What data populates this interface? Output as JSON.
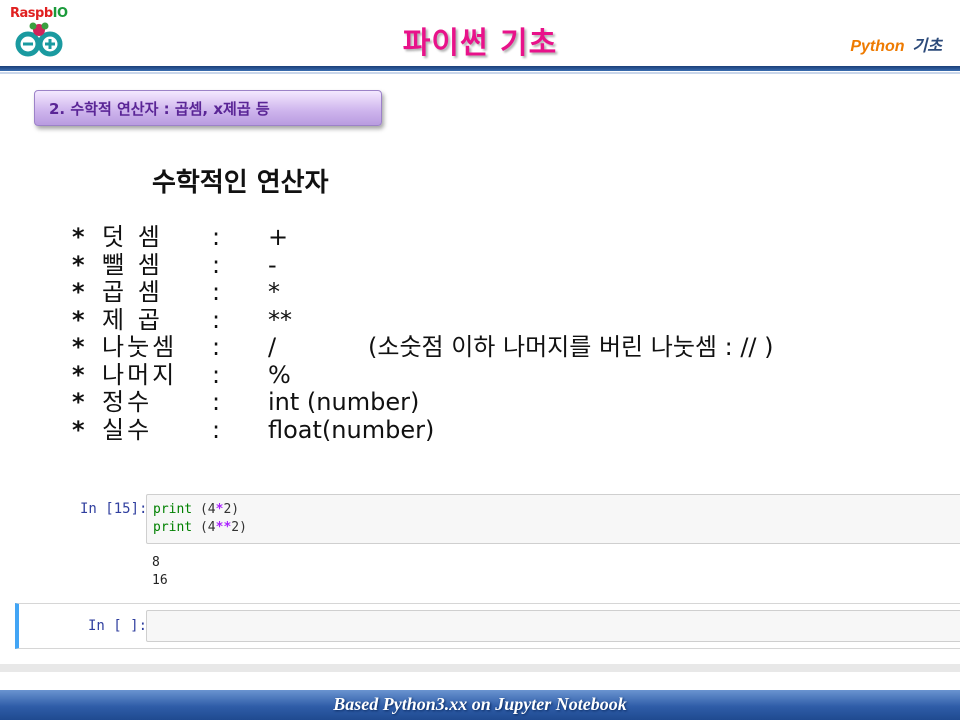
{
  "header": {
    "logo_text_a": "Raspb",
    "logo_text_b": "IO",
    "title": "파이썬 기초",
    "right_label_en": "Python",
    "right_label_ko": "기초"
  },
  "section": {
    "badge": "2. 수학적 연산자 : 곱셈, x제곱 등"
  },
  "operators": {
    "title": "수학적인 연산자",
    "items": [
      {
        "bullet": "*",
        "name": "덧 셈",
        "colon": ":",
        "symbol": "+",
        "note": ""
      },
      {
        "bullet": "*",
        "name": "뺄 셈",
        "colon": ":",
        "symbol": "-",
        "note": ""
      },
      {
        "bullet": "*",
        "name": "곱 셈",
        "colon": ":",
        "symbol": "*",
        "note": ""
      },
      {
        "bullet": "*",
        "name": "제 곱",
        "colon": ":",
        "symbol": "**",
        "note": ""
      },
      {
        "bullet": "*",
        "name": "나눗셈",
        "colon": ":",
        "symbol": "/",
        "note": "(소숫점 이하 나머지를 버린 나눗셈 :  // )"
      },
      {
        "bullet": "*",
        "name": "나머지",
        "colon": ":",
        "symbol": "%",
        "note": ""
      },
      {
        "bullet": "*",
        "name": "정수",
        "colon": ":",
        "symbol": "int (number)",
        "note": ""
      },
      {
        "bullet": "*",
        "name": "실수",
        "colon": ":",
        "symbol": "float(number)",
        "note": ""
      }
    ]
  },
  "notebook": {
    "cell1": {
      "prompt": "In [15]:",
      "lines": [
        {
          "fn": "print",
          "open": " (4",
          "op": "*",
          "rest": "2)"
        },
        {
          "fn": "print",
          "open": " (4",
          "op": "**",
          "rest": "2)"
        }
      ],
      "output": [
        "8",
        "16"
      ]
    },
    "cell2": {
      "prompt": "In [ ]:",
      "code": ""
    }
  },
  "footer": {
    "text": "Based  Python3.xx   on Jupyter Notebook"
  },
  "colors": {
    "title_pink": "#e8128a",
    "header_orange": "#ee7a00",
    "badge_purple": "#cdb3ec",
    "footer_blue": "#2f5da8",
    "active_cell_blue": "#42a5f5"
  }
}
